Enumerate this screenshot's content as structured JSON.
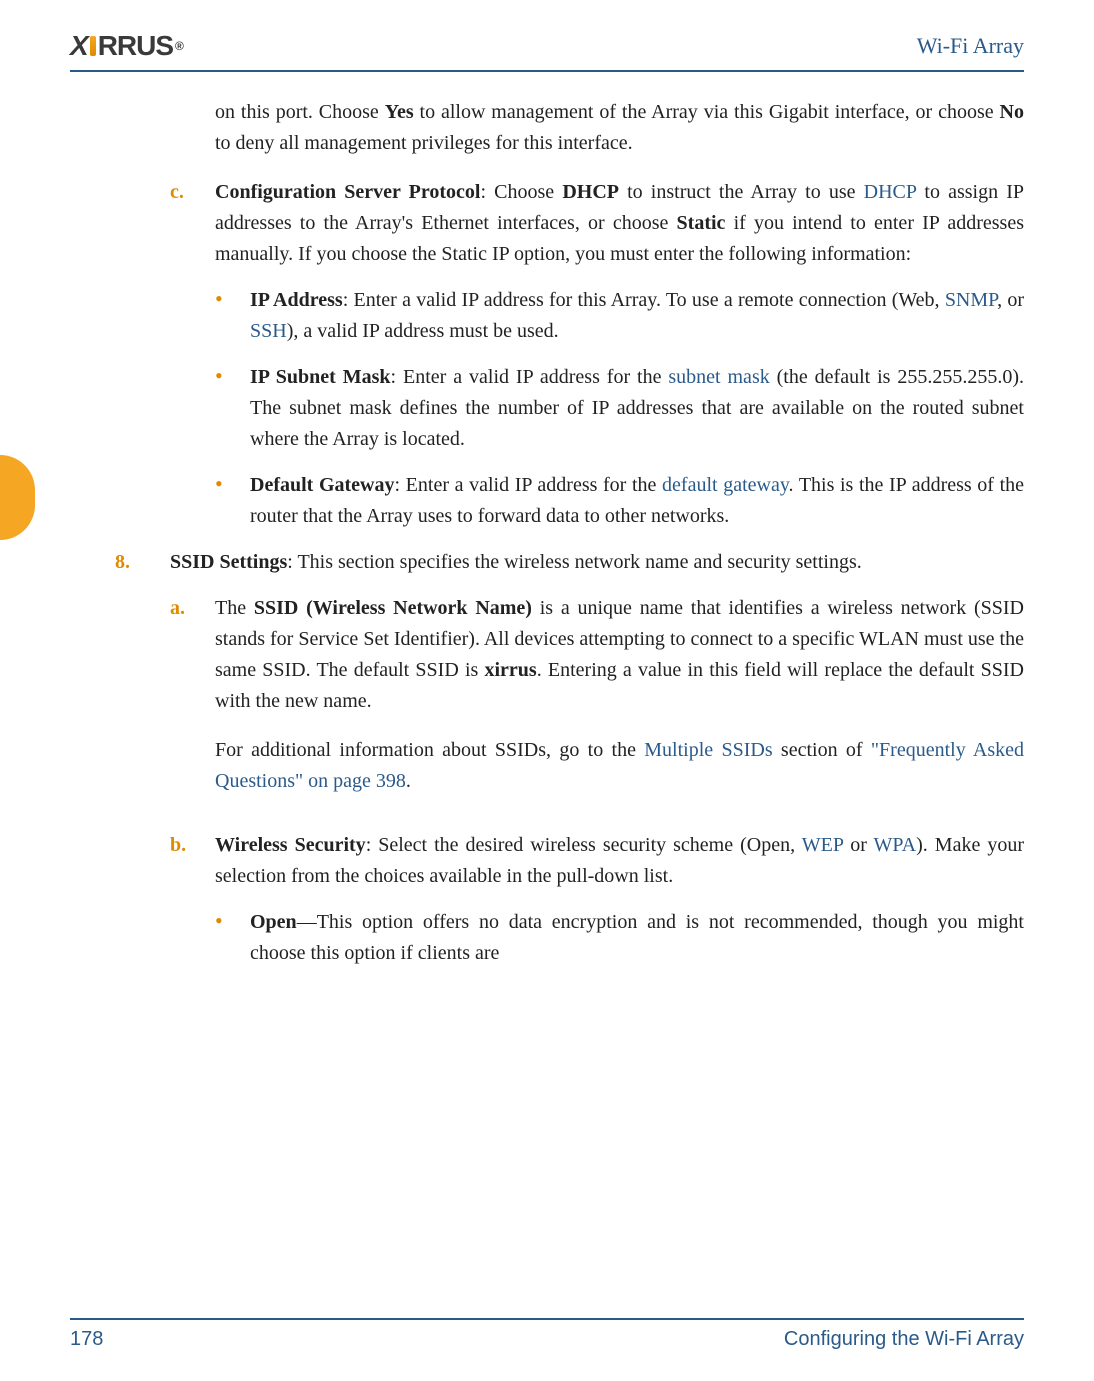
{
  "header": {
    "logo_text": "XIRRUS",
    "title": "Wi-Fi Array"
  },
  "intro_para": {
    "t1": "on this port. Choose ",
    "b1": "Yes",
    "t2": " to allow management of the Array via this Gigabit interface, or choose ",
    "b2": "No",
    "t3": " to deny all management privileges for this interface."
  },
  "item_c": {
    "marker": "c.",
    "b1": "Configuration Server Protocol",
    "t1": ": Choose ",
    "b2": "DHCP",
    "t2": " to instruct the Array to use ",
    "l1": "DHCP",
    "t3": " to assign IP addresses to the Array's Ethernet interfaces, or choose ",
    "b3": "Static",
    "t4": " if you intend to enter IP addresses manually. If you choose the Static IP option, you must enter the following information:"
  },
  "bullet1": {
    "b1": "IP Address",
    "t1": ": Enter a valid IP address for this Array. To use a remote connection (Web, ",
    "l1": "SNMP",
    "t2": ", or ",
    "l2": "SSH",
    "t3": "), a valid IP address must be used."
  },
  "bullet2": {
    "b1": "IP Subnet Mask",
    "t1": ": Enter a valid IP address for the ",
    "l1": "subnet mask",
    "t2": " (the default is 255.255.255.0). The subnet mask defines the number of IP addresses that are available on the routed subnet where the Array is located."
  },
  "bullet3": {
    "b1": "Default Gateway",
    "t1": ": Enter a valid IP address for the ",
    "l1": "default gateway",
    "t2": ". This is the IP address of the router that the Array uses to forward data to other networks."
  },
  "item_8": {
    "marker": "8.",
    "b1": "SSID Settings",
    "t1": ": This section specifies the wireless network name and security settings."
  },
  "item_a": {
    "marker": "a.",
    "t1": "The ",
    "b1": "SSID (Wireless Network Name)",
    "t2": " is a unique name that identifies a wireless network (SSID stands for Service Set Identifier). All devices attempting to connect to a specific WLAN must use the same SSID. The default SSID is ",
    "b2": "xirrus",
    "t3": ". Entering a value in this field will replace the default SSID with the new name.",
    "p2_t1": "For additional information about SSIDs, go to the ",
    "p2_l1": "Multiple SSIDs",
    "p2_t2": " section of ",
    "p2_l2": "\"Frequently Asked Questions\" on page 398",
    "p2_t3": "."
  },
  "item_b": {
    "marker": "b.",
    "b1": "Wireless Security",
    "t1": ": Select the desired wireless security scheme (Open, ",
    "l1": "WEP",
    "t2": " or ",
    "l2": "WPA",
    "t3": "). Make your selection from the choices available in the pull-down list."
  },
  "bullet_open": {
    "b1": "Open",
    "t1": "—This option offers no data encryption and is not recommended, though you might choose this option if clients are"
  },
  "footer": {
    "page": "178",
    "title": "Configuring the Wi-Fi Array"
  }
}
